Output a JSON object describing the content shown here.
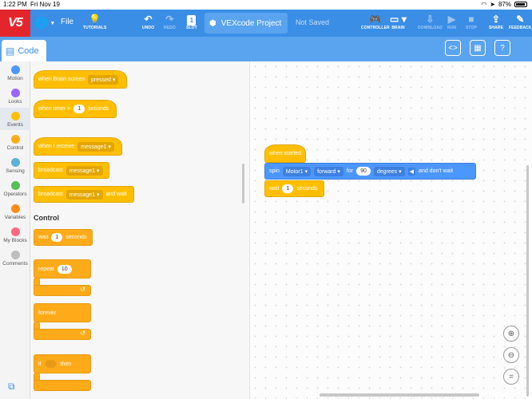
{
  "statusbar": {
    "time": "1:22 PM",
    "date": "Fri Nov 19",
    "battery": "87%"
  },
  "toolbar": {
    "logo": "V5",
    "file": "File",
    "tutorials": "TUTORIALS",
    "undo": "UNDO",
    "redo": "REDO",
    "slot": "SLOT",
    "slot_number": "1",
    "project_name": "VEXcode Project",
    "save_status": "Not Saved",
    "controller": "CONTROLLER",
    "brain": "BRAIN",
    "download": "DOWNLOAD",
    "run": "RUN",
    "stop": "STOP",
    "share": "SHARE",
    "feedback": "FEEDBACK"
  },
  "subbar": {
    "code_tab": "Code"
  },
  "categories": [
    {
      "label": "Motion",
      "color": "#4c97ff"
    },
    {
      "label": "Looks",
      "color": "#9966ff"
    },
    {
      "label": "Events",
      "color": "#ffbf00"
    },
    {
      "label": "Control",
      "color": "#ffab19"
    },
    {
      "label": "Sensing",
      "color": "#5cb1d6"
    },
    {
      "label": "Operators",
      "color": "#59c059"
    },
    {
      "label": "Variables",
      "color": "#ff8c1a"
    },
    {
      "label": "My Blocks",
      "color": "#ff6680"
    },
    {
      "label": "Comments",
      "color": "#bdbdbd"
    }
  ],
  "palette": {
    "when_brain_screen": "when Brain screen",
    "pressed": "pressed",
    "when_timer": "when timer >",
    "timer_value": "1",
    "seconds": "seconds",
    "when_i_receive": "when I receive",
    "message1": "message1",
    "broadcast": "broadcast",
    "and_wait": "and wait",
    "control_title": "Control",
    "wait": "wait",
    "wait_value": "1",
    "repeat": "repeat",
    "repeat_value": "10",
    "forever": "forever",
    "if": "if",
    "then": "then"
  },
  "workspace": {
    "when_started": "when started",
    "spin": "spin",
    "motor": "Motor1",
    "direction": "forward",
    "for": "for",
    "amount": "90",
    "unit": "degrees",
    "and_dont_wait": "and don't wait",
    "wait": "wait",
    "wait_value": "1",
    "seconds": "seconds"
  }
}
